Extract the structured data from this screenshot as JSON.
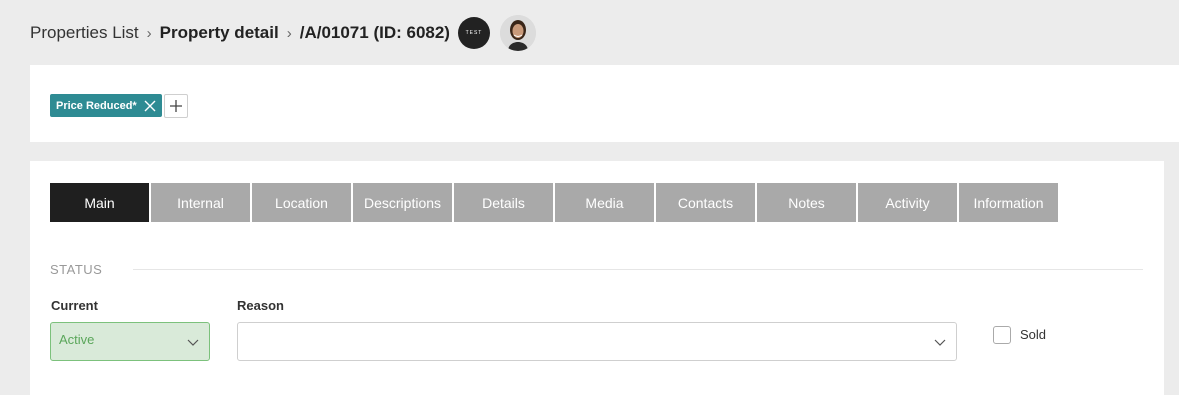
{
  "breadcrumb": {
    "item1": "Properties List",
    "sep": "›",
    "item2": "Property detail",
    "ref": "/A/01071 (ID: 6082)",
    "badge": "TEST"
  },
  "tags": {
    "tag1": "Price Reduced*",
    "add_symbol": "+"
  },
  "tabs": [
    "Main",
    "Internal",
    "Location",
    "Descriptions",
    "Details",
    "Media",
    "Contacts",
    "Notes",
    "Activity",
    "Information"
  ],
  "status": {
    "section_title": "STATUS",
    "current_label": "Current",
    "current_value": "Active",
    "reason_label": "Reason",
    "reason_value": "",
    "sold_label": "Sold"
  },
  "colors": {
    "tag_bg": "#2e8b93",
    "active_tab": "#1f1f1f",
    "inactive_tab": "#a9a9a9",
    "active_status_bg": "#d9ead9",
    "active_status_text": "#5aa65a"
  }
}
